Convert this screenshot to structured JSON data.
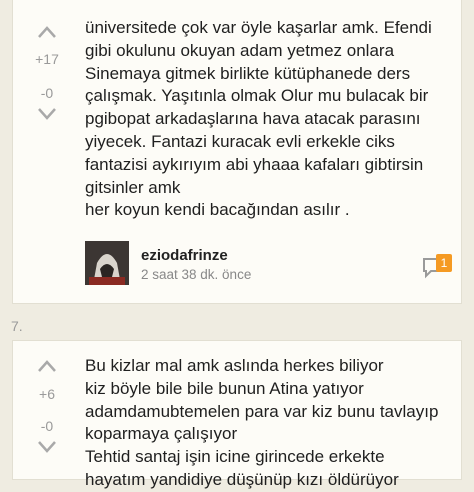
{
  "entries": [
    {
      "vote_up_icon": "chevron-up-icon",
      "vote_down_icon": "chevron-down-icon",
      "plus_count": "+17",
      "minus_count": "-0",
      "lines": [
        "üniversitede çok var öyle kaşarlar amk. Efendi",
        "gibi okulunu okuyan adam yetmez onlara",
        "Sinemaya gitmek birlikte kütüphanede ders",
        "çalışmak. Yaşıtınla olmak Olur mu bulacak bir",
        "pgibopat arkadaşlarına hava atacak parasını",
        "yiyecek. Fantazi kuracak evli erkekle ciks",
        "fantazisi aykırıyım abi yhaaa kafaları gibtirsin",
        "gitsinler amk",
        "her koyun kendi bacağından asılır ."
      ],
      "author": "eziodafrinze",
      "time": "2 saat 38 dk. önce",
      "comment_icon": "speech-bubble-icon",
      "comment_count": "1"
    },
    {
      "number": "7.",
      "plus_count": "+6",
      "minus_count": "-0",
      "lines": [
        "Bu kizlar mal amk aslında herkes biliyor",
        "kiz böyle bile bile bunun Atina yatıyor",
        "adamdamubtemelen para var kiz bunu tavlayıp",
        "koparmaya çalışıyor",
        "Tehtid santaj işin icine girincede erkekte",
        "hayatım yandidiye düşünüp kızı öldürüyor"
      ]
    }
  ],
  "colors": {
    "badge": "#f59a23",
    "background": "#efece1",
    "card": "#fdfcf7"
  }
}
